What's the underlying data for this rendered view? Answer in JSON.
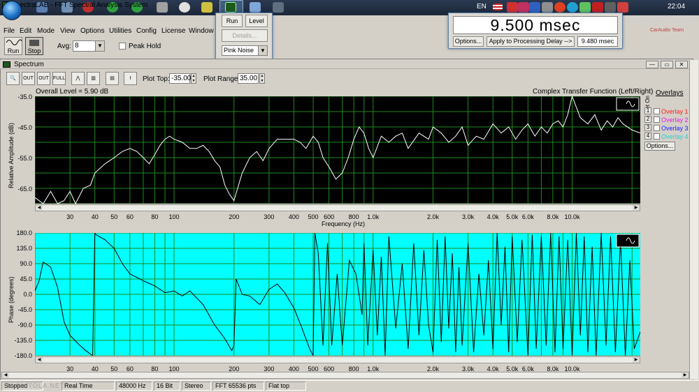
{
  "taskbar": {
    "language": "EN",
    "clock": "22:04"
  },
  "app": {
    "title": "SpectraLAB - FFT Spectral Analysis System",
    "menu": [
      "File",
      "Edit",
      "Mode",
      "View",
      "Options",
      "Utilities",
      "Config",
      "License",
      "Window"
    ]
  },
  "toolbar": {
    "run_label": "Run",
    "stop_label": "Stop",
    "avg_label": "Avg:",
    "avg_value": "8",
    "peak_hold_label": "Peak Hold"
  },
  "run_popup": {
    "run_label": "Run",
    "level_label": "Level",
    "details_label": "Details...",
    "signal_value": "Pink Noise"
  },
  "delay_popup": {
    "display": "9.500 msec",
    "options_label": "Options...",
    "apply_label": "Apply to Processing Delay -->",
    "applied_value": "9.480 msec"
  },
  "watermark": {
    "logo_text": "MAGNITOLA",
    "sub_text": "CarAudio Team",
    "bottom_text": "MAGNITOLA.NET"
  },
  "spectrum": {
    "window_title": "Spectrum",
    "tool_buttons": [
      "search-icon",
      "zoom-out-icon",
      "zoom-in-icon",
      "zoom-full-icon",
      "peak-icon",
      "bars-icon",
      "table-icon",
      "marker-icon"
    ],
    "plot_top_label": "Plot Top:",
    "plot_top_value": "-35.00",
    "plot_range_label": "Plot Range:",
    "plot_range_value": "35.00",
    "overall_level": "Overall Level = 5.90 dB",
    "transfer_label": "Complex Transfer Function (Left/Right)",
    "overlays_title": "Overlays",
    "set_on_label": "Set On",
    "overlays": [
      {
        "num": "1",
        "label": "Overlay 1",
        "color": "#ff2020"
      },
      {
        "num": "2",
        "label": "Overlay 2",
        "color": "#e020e0"
      },
      {
        "num": "3",
        "label": "Overlay 3",
        "color": "#2020ff"
      },
      {
        "num": "4",
        "label": "Overlay 4",
        "color": "#20d0d0"
      }
    ],
    "options_label": "Options..."
  },
  "chart_data": [
    {
      "type": "line",
      "title": "Complex Transfer Function (Left/Right)",
      "xlabel": "Frequency (Hz)",
      "ylabel": "Relative Amplitude (dB)",
      "x_scale": "log",
      "xlim": [
        20,
        22000
      ],
      "ylim": [
        -70,
        -35
      ],
      "yticks": [
        "-35.0",
        "-45.0",
        "-55.0",
        "-65.0"
      ],
      "xticks": [
        "30",
        "40",
        "50",
        "60",
        "80",
        "100",
        "200",
        "300",
        "400",
        "500",
        "600",
        "800",
        "1.0k",
        "2.0k",
        "3.0k",
        "4.0k",
        "5.0k",
        "6.0k",
        "8.0k",
        "10.0k"
      ],
      "background": "#000000",
      "grid_color": "#1e8a1e",
      "line_color": "#ffffff",
      "series": [
        {
          "x": [
            20,
            22,
            24,
            26,
            28,
            30,
            32,
            35,
            38,
            40,
            45,
            50,
            55,
            60,
            65,
            70,
            75,
            80,
            85,
            90,
            95,
            100,
            110,
            120,
            130,
            140,
            150,
            160,
            170,
            180,
            190,
            200,
            220,
            240,
            260,
            280,
            300,
            330,
            360,
            400,
            430,
            460,
            500,
            530,
            560,
            600,
            650,
            700,
            750,
            800,
            850,
            900,
            950,
            1000,
            1100,
            1200,
            1300,
            1400,
            1500,
            1700,
            1900,
            2000,
            2200,
            2400,
            2600,
            2800,
            3000,
            3300,
            3600,
            4000,
            4400,
            4800,
            5200,
            5600,
            6000,
            6500,
            7000,
            7500,
            8000,
            8500,
            9000,
            9500,
            10000,
            11000,
            12000,
            13000,
            14000,
            15000,
            16000,
            17000,
            18000,
            20000,
            22000
          ],
          "y": [
            -68,
            -70,
            -66,
            -70,
            -69,
            -66,
            -70,
            -65,
            -64,
            -60,
            -57,
            -55,
            -53,
            -52,
            -53,
            -55,
            -57,
            -54,
            -51,
            -49,
            -48,
            -49,
            -50,
            -52,
            -52,
            -51,
            -53,
            -56,
            -58,
            -64,
            -67,
            -69,
            -60,
            -55,
            -53,
            -56,
            -52,
            -49,
            -49,
            -49,
            -50,
            -52,
            -48,
            -50,
            -55,
            -58,
            -62,
            -60,
            -55,
            -49,
            -45,
            -47,
            -52,
            -55,
            -48,
            -50,
            -48,
            -47,
            -52,
            -47,
            -49,
            -45,
            -47,
            -50,
            -48,
            -45,
            -51,
            -48,
            -49,
            -44,
            -47,
            -45,
            -49,
            -46,
            -44,
            -48,
            -45,
            -47,
            -44,
            -43,
            -45,
            -41,
            -35,
            -42,
            -44,
            -41,
            -46,
            -43,
            -45,
            -42,
            -44,
            -46,
            -47
          ]
        }
      ]
    },
    {
      "type": "line",
      "xlabel": "",
      "ylabel": "Phase (degrees)",
      "x_scale": "log",
      "xlim": [
        20,
        22000
      ],
      "ylim": [
        -180,
        180
      ],
      "yticks": [
        "180.0",
        "135.0",
        "90.0",
        "45.0",
        "0.0",
        "-45.0",
        "-90.0",
        "-135.0",
        "-180.0"
      ],
      "xticks": [
        "30",
        "40",
        "50",
        "60",
        "80",
        "100",
        "200",
        "300",
        "400",
        "500",
        "600",
        "800",
        "1.0k",
        "2.0k",
        "3.0k",
        "4.0k",
        "5.0k",
        "6.0k",
        "8.0k",
        "10.0k"
      ],
      "background": "#00ffff",
      "grid_color": "#1e8a1e",
      "line_color": "#000000",
      "series": [
        {
          "x": [
            20,
            21,
            22,
            24,
            26,
            28,
            30,
            33,
            36,
            39,
            40,
            40.5,
            45,
            50,
            55,
            60,
            70,
            80,
            90,
            100,
            110,
            120,
            140,
            160,
            180,
            195,
            200,
            205,
            220,
            240,
            270,
            300,
            330,
            360,
            400,
            440,
            480,
            500,
            510,
            530,
            560,
            590,
            620,
            660,
            700,
            760,
            820,
            880,
            900,
            940,
            1000,
            1050,
            1100,
            1150,
            1200,
            1300,
            1400,
            1500,
            1600,
            1700,
            1800,
            1900,
            2000,
            2100,
            2200,
            2300,
            2400,
            2500,
            2600,
            2700,
            2800,
            3000,
            3200,
            3400,
            3600,
            3800,
            4000,
            4200,
            4400,
            4600,
            4800,
            5000,
            5300,
            5600,
            6000,
            6300,
            6600,
            7000,
            7400,
            7800,
            8200,
            8600,
            9000,
            9500,
            10000,
            10500,
            11000,
            11500,
            12000,
            12600,
            13200,
            14000,
            14800,
            15600,
            16500,
            17500,
            18500,
            19500,
            20500,
            22000
          ],
          "y": [
            10,
            40,
            95,
            80,
            20,
            -80,
            -120,
            -145,
            -165,
            -180,
            180,
            175,
            160,
            135,
            90,
            60,
            40,
            25,
            5,
            10,
            -5,
            10,
            -30,
            -90,
            -130,
            -165,
            -150,
            45,
            0,
            -5,
            -30,
            15,
            30,
            5,
            -40,
            -100,
            -160,
            -180,
            180,
            120,
            -150,
            150,
            -150,
            60,
            -150,
            100,
            60,
            -60,
            150,
            -150,
            130,
            -120,
            110,
            -180,
            170,
            -100,
            90,
            -160,
            150,
            -120,
            130,
            -90,
            -170,
            160,
            -140,
            170,
            -100,
            120,
            -170,
            80,
            -150,
            150,
            -170,
            60,
            -120,
            100,
            -160,
            180,
            -90,
            140,
            -170,
            170,
            -140,
            160,
            -180,
            175,
            -160,
            170,
            -150,
            180,
            -170,
            170,
            -160,
            160,
            -180,
            180,
            -120,
            170,
            -170,
            140,
            -180,
            180,
            -150,
            170,
            -170,
            160,
            -180,
            100,
            -160,
            -110
          ]
        }
      ]
    }
  ],
  "status": [
    "Stopped",
    "Real Time",
    "48000 Hz",
    "16 Bit",
    "Stereo",
    "FFT 65536 pts",
    "Flat top"
  ]
}
